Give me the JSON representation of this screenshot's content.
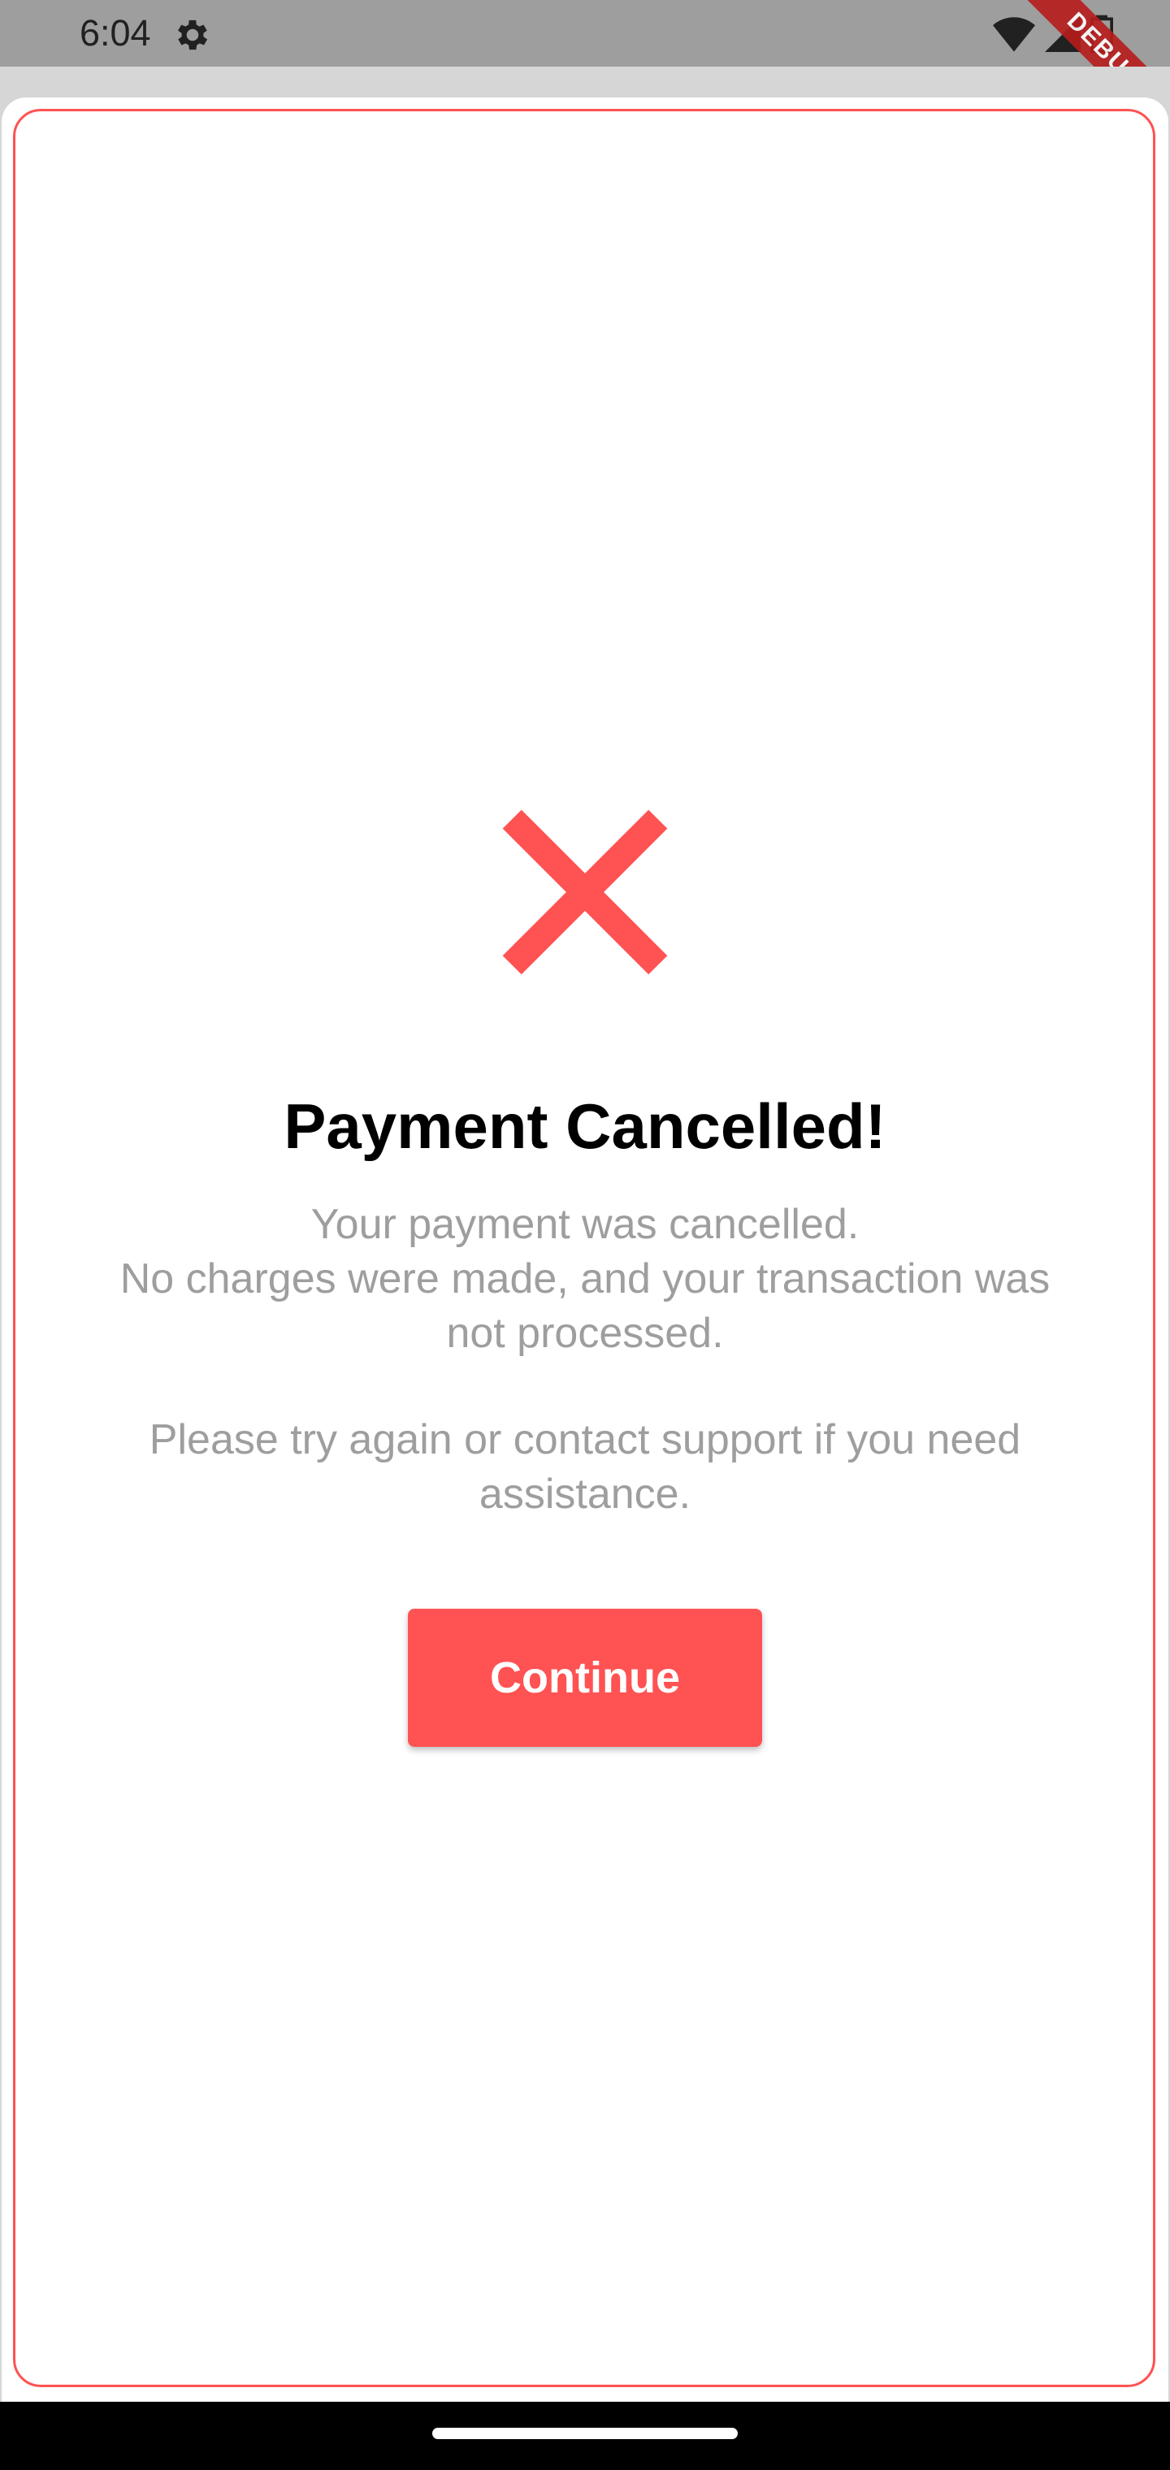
{
  "status_bar": {
    "time": "6:04",
    "icons": [
      "settings-gear-icon",
      "wifi-icon",
      "cell-signal-icon",
      "battery-icon"
    ]
  },
  "debug_banner": "DEBUG",
  "dialog": {
    "icon": "close-x-icon",
    "title": "Payment Cancelled!",
    "message_line1": "Your payment was cancelled.",
    "message_line2": "No charges were made, and your transaction was not processed.",
    "message_line3": "Please try again or contact support if you need assistance.",
    "continue_label": "Continue"
  },
  "colors": {
    "accent": "#ff5252",
    "title": "#000000",
    "message": "#9e9e9e",
    "status_bar": "#9e9e9e"
  }
}
